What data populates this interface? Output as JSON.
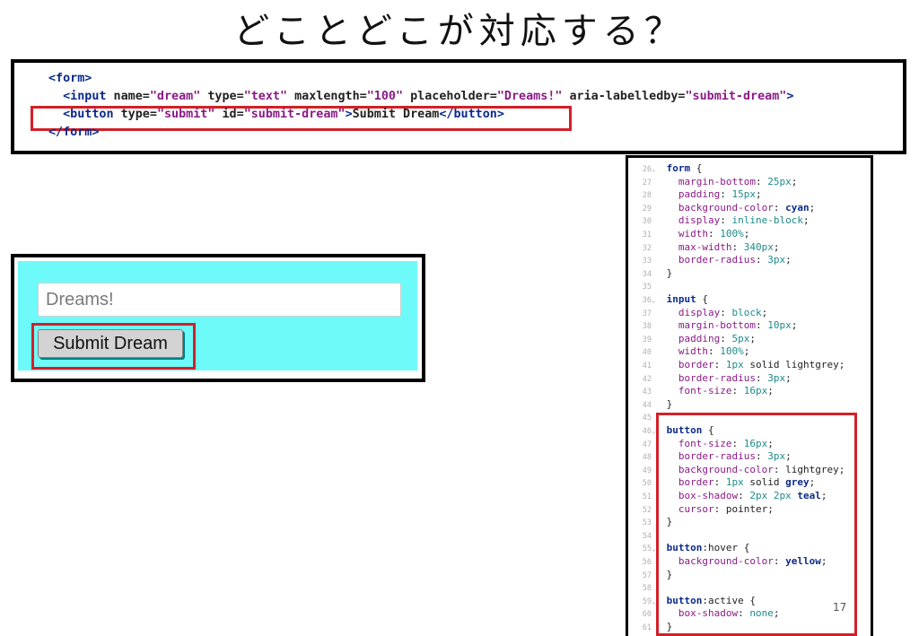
{
  "slide": {
    "title": "どことどこが対応する？",
    "page_number": "17"
  },
  "html_snippet": {
    "lines": [
      {
        "indent": "",
        "parts": [
          {
            "t": "tag",
            "v": "<form>"
          }
        ]
      },
      {
        "indent": "  ",
        "parts": [
          {
            "t": "tag",
            "v": "<input"
          },
          {
            "t": "attr",
            "v": " name="
          },
          {
            "t": "val",
            "v": "\"dream\""
          },
          {
            "t": "attr",
            "v": " type="
          },
          {
            "t": "val",
            "v": "\"text\""
          },
          {
            "t": "attr",
            "v": " maxlength="
          },
          {
            "t": "val",
            "v": "\"100\""
          },
          {
            "t": "attr",
            "v": " placeholder="
          },
          {
            "t": "val",
            "v": "\"Dreams!\""
          },
          {
            "t": "attr",
            "v": " aria-labelledby="
          },
          {
            "t": "val",
            "v": "\"submit-dream\""
          },
          {
            "t": "tag",
            "v": ">"
          }
        ]
      },
      {
        "indent": "  ",
        "parts": [
          {
            "t": "tag",
            "v": "<button"
          },
          {
            "t": "attr",
            "v": " type="
          },
          {
            "t": "val",
            "v": "\"submit\""
          },
          {
            "t": "attr",
            "v": " id="
          },
          {
            "t": "val",
            "v": "\"submit-dream\""
          },
          {
            "t": "tag",
            "v": ">"
          },
          {
            "t": "attr",
            "v": "Submit Dream"
          },
          {
            "t": "tag",
            "v": "</button>"
          }
        ]
      },
      {
        "indent": "",
        "parts": [
          {
            "t": "tag",
            "v": "</form>"
          }
        ]
      }
    ]
  },
  "preview": {
    "input_placeholder": "Dreams!",
    "button_label": "Submit Dream",
    "form_background": "#6ffafa"
  },
  "css_code": {
    "lines": [
      {
        "n": "26",
        "fold": true,
        "parts": [
          {
            "t": "sel",
            "v": "form"
          },
          {
            "t": "plain",
            "v": " {"
          }
        ]
      },
      {
        "n": "27",
        "parts": [
          {
            "t": "prop",
            "v": "  margin-bottom"
          },
          {
            "t": "plain",
            "v": ": "
          },
          {
            "t": "numv",
            "v": "25px"
          },
          {
            "t": "plain",
            "v": ";"
          }
        ]
      },
      {
        "n": "28",
        "parts": [
          {
            "t": "prop",
            "v": "  padding"
          },
          {
            "t": "plain",
            "v": ": "
          },
          {
            "t": "numv",
            "v": "15px"
          },
          {
            "t": "plain",
            "v": ";"
          }
        ]
      },
      {
        "n": "29",
        "parts": [
          {
            "t": "prop",
            "v": "  background-color"
          },
          {
            "t": "plain",
            "v": ": "
          },
          {
            "t": "kw",
            "v": "cyan"
          },
          {
            "t": "plain",
            "v": ";"
          }
        ]
      },
      {
        "n": "30",
        "parts": [
          {
            "t": "prop",
            "v": "  display"
          },
          {
            "t": "plain",
            "v": ": "
          },
          {
            "t": "numv",
            "v": "inline-block"
          },
          {
            "t": "plain",
            "v": ";"
          }
        ]
      },
      {
        "n": "31",
        "parts": [
          {
            "t": "prop",
            "v": "  width"
          },
          {
            "t": "plain",
            "v": ": "
          },
          {
            "t": "numv",
            "v": "100%"
          },
          {
            "t": "plain",
            "v": ";"
          }
        ]
      },
      {
        "n": "32",
        "parts": [
          {
            "t": "prop",
            "v": "  max-width"
          },
          {
            "t": "plain",
            "v": ": "
          },
          {
            "t": "numv",
            "v": "340px"
          },
          {
            "t": "plain",
            "v": ";"
          }
        ]
      },
      {
        "n": "33",
        "parts": [
          {
            "t": "prop",
            "v": "  border-radius"
          },
          {
            "t": "plain",
            "v": ": "
          },
          {
            "t": "numv",
            "v": "3px"
          },
          {
            "t": "plain",
            "v": ";"
          }
        ]
      },
      {
        "n": "34",
        "parts": [
          {
            "t": "plain",
            "v": "}"
          }
        ]
      },
      {
        "n": "35",
        "parts": []
      },
      {
        "n": "36",
        "fold": true,
        "parts": [
          {
            "t": "sel",
            "v": "input"
          },
          {
            "t": "plain",
            "v": " {"
          }
        ]
      },
      {
        "n": "37",
        "parts": [
          {
            "t": "prop",
            "v": "  display"
          },
          {
            "t": "plain",
            "v": ": "
          },
          {
            "t": "numv",
            "v": "block"
          },
          {
            "t": "plain",
            "v": ";"
          }
        ]
      },
      {
        "n": "38",
        "parts": [
          {
            "t": "prop",
            "v": "  margin-bottom"
          },
          {
            "t": "plain",
            "v": ": "
          },
          {
            "t": "numv",
            "v": "10px"
          },
          {
            "t": "plain",
            "v": ";"
          }
        ]
      },
      {
        "n": "39",
        "parts": [
          {
            "t": "prop",
            "v": "  padding"
          },
          {
            "t": "plain",
            "v": ": "
          },
          {
            "t": "numv",
            "v": "5px"
          },
          {
            "t": "plain",
            "v": ";"
          }
        ]
      },
      {
        "n": "40",
        "parts": [
          {
            "t": "prop",
            "v": "  width"
          },
          {
            "t": "plain",
            "v": ": "
          },
          {
            "t": "numv",
            "v": "100%"
          },
          {
            "t": "plain",
            "v": ";"
          }
        ]
      },
      {
        "n": "41",
        "parts": [
          {
            "t": "prop",
            "v": "  border"
          },
          {
            "t": "plain",
            "v": ": "
          },
          {
            "t": "numv",
            "v": "1px"
          },
          {
            "t": "plain",
            "v": " solid lightgrey;"
          }
        ]
      },
      {
        "n": "42",
        "parts": [
          {
            "t": "prop",
            "v": "  border-radius"
          },
          {
            "t": "plain",
            "v": ": "
          },
          {
            "t": "numv",
            "v": "3px"
          },
          {
            "t": "plain",
            "v": ";"
          }
        ]
      },
      {
        "n": "43",
        "parts": [
          {
            "t": "prop",
            "v": "  font-size"
          },
          {
            "t": "plain",
            "v": ": "
          },
          {
            "t": "numv",
            "v": "16px"
          },
          {
            "t": "plain",
            "v": ";"
          }
        ]
      },
      {
        "n": "44",
        "parts": [
          {
            "t": "plain",
            "v": "}"
          }
        ]
      },
      {
        "n": "45",
        "parts": []
      },
      {
        "n": "46",
        "fold": true,
        "parts": [
          {
            "t": "sel",
            "v": "button"
          },
          {
            "t": "plain",
            "v": " {"
          }
        ]
      },
      {
        "n": "47",
        "parts": [
          {
            "t": "prop",
            "v": "  font-size"
          },
          {
            "t": "plain",
            "v": ": "
          },
          {
            "t": "numv",
            "v": "16px"
          },
          {
            "t": "plain",
            "v": ";"
          }
        ]
      },
      {
        "n": "48",
        "parts": [
          {
            "t": "prop",
            "v": "  border-radius"
          },
          {
            "t": "plain",
            "v": ": "
          },
          {
            "t": "numv",
            "v": "3px"
          },
          {
            "t": "plain",
            "v": ";"
          }
        ]
      },
      {
        "n": "49",
        "parts": [
          {
            "t": "prop",
            "v": "  background-color"
          },
          {
            "t": "plain",
            "v": ": lightgrey;"
          }
        ]
      },
      {
        "n": "50",
        "parts": [
          {
            "t": "prop",
            "v": "  border"
          },
          {
            "t": "plain",
            "v": ": "
          },
          {
            "t": "numv",
            "v": "1px"
          },
          {
            "t": "plain",
            "v": " solid "
          },
          {
            "t": "kw",
            "v": "grey"
          },
          {
            "t": "plain",
            "v": ";"
          }
        ]
      },
      {
        "n": "51",
        "parts": [
          {
            "t": "prop",
            "v": "  box-shadow"
          },
          {
            "t": "plain",
            "v": ": "
          },
          {
            "t": "numv",
            "v": "2px 2px"
          },
          {
            "t": "plain",
            "v": " "
          },
          {
            "t": "kw",
            "v": "teal"
          },
          {
            "t": "plain",
            "v": ";"
          }
        ]
      },
      {
        "n": "52",
        "parts": [
          {
            "t": "prop",
            "v": "  cursor"
          },
          {
            "t": "plain",
            "v": ": pointer;"
          }
        ]
      },
      {
        "n": "53",
        "parts": [
          {
            "t": "plain",
            "v": "}"
          }
        ]
      },
      {
        "n": "54",
        "parts": []
      },
      {
        "n": "55",
        "fold": true,
        "parts": [
          {
            "t": "sel",
            "v": "button"
          },
          {
            "t": "plain",
            "v": ":hover {"
          }
        ]
      },
      {
        "n": "56",
        "parts": [
          {
            "t": "prop",
            "v": "  background-color"
          },
          {
            "t": "plain",
            "v": ": "
          },
          {
            "t": "kw",
            "v": "yellow"
          },
          {
            "t": "plain",
            "v": ";"
          }
        ]
      },
      {
        "n": "57",
        "parts": [
          {
            "t": "plain",
            "v": "}"
          }
        ]
      },
      {
        "n": "58",
        "parts": []
      },
      {
        "n": "59",
        "fold": true,
        "parts": [
          {
            "t": "sel",
            "v": "button"
          },
          {
            "t": "plain",
            "v": ":active {"
          }
        ]
      },
      {
        "n": "60",
        "parts": [
          {
            "t": "prop",
            "v": "  box-shadow"
          },
          {
            "t": "plain",
            "v": ": "
          },
          {
            "t": "numv",
            "v": "none"
          },
          {
            "t": "plain",
            "v": ";"
          }
        ]
      },
      {
        "n": "61",
        "parts": [
          {
            "t": "plain",
            "v": "}"
          }
        ]
      }
    ]
  }
}
